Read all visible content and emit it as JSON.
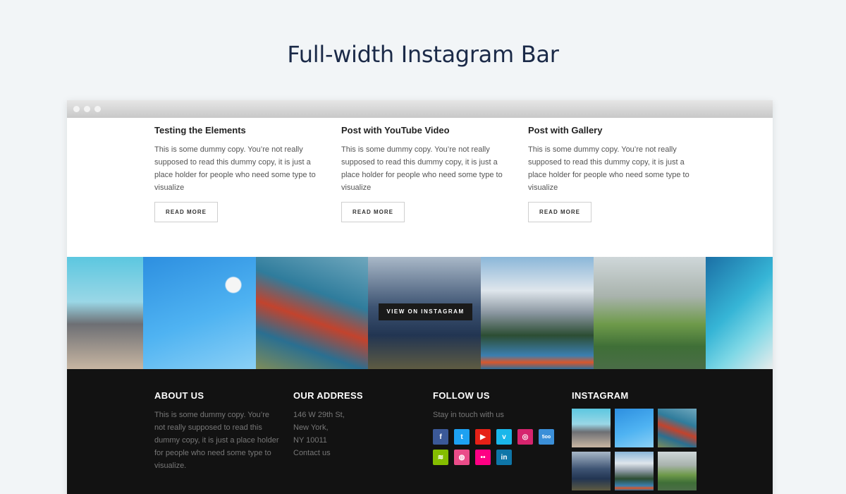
{
  "page_title": "Full-width Instagram Bar",
  "posts": [
    {
      "title": "Testing the Elements",
      "excerpt": "This is some dummy copy. You’re not really supposed to read this dummy copy, it is just a place holder for people who need some type to visualize",
      "button": "READ MORE"
    },
    {
      "title": "Post with YouTube Video",
      "excerpt": "This is some dummy copy. You’re not really supposed to read this dummy copy, it is just a place holder for people who need some type to visualize",
      "button": "READ MORE"
    },
    {
      "title": "Post with Gallery",
      "excerpt": "This is some dummy copy. You’re not really supposed to read this dummy copy, it is just a place holder for people who need some type to visualize",
      "button": "READ MORE"
    }
  ],
  "instagram_bar": {
    "button": "VIEW ON INSTAGRAM"
  },
  "footer": {
    "about": {
      "heading": "ABOUT US",
      "text": "This is some dummy copy. You’re not really supposed to read this dummy copy, it is just a place holder for people who need some type to visualize."
    },
    "address": {
      "heading": "OUR ADDRESS",
      "line1": "146 W 29th St,",
      "line2": "New York,",
      "line3": "NY 10011",
      "contact": "Contact us"
    },
    "follow": {
      "heading": "FOLLOW US",
      "text": "Stay in touch with us",
      "icons": [
        {
          "name": "facebook-icon",
          "glyph": "f",
          "color": "#3b5998"
        },
        {
          "name": "twitter-icon",
          "glyph": "t",
          "color": "#1da1f2"
        },
        {
          "name": "youtube-icon",
          "glyph": "▶",
          "color": "#e62117"
        },
        {
          "name": "vimeo-icon",
          "glyph": "v",
          "color": "#1ab7ea"
        },
        {
          "name": "instagram-icon",
          "glyph": "◎",
          "color": "#d6246e"
        },
        {
          "name": "500px-icon",
          "glyph": "5oo",
          "color": "#3b8fd8"
        },
        {
          "name": "spotify-icon",
          "glyph": "≋",
          "color": "#84bd00"
        },
        {
          "name": "dribbble-icon",
          "glyph": "◍",
          "color": "#ea4c89"
        },
        {
          "name": "flickr-icon",
          "glyph": "••",
          "color": "#ff0084"
        },
        {
          "name": "linkedin-icon",
          "glyph": "in",
          "color": "#0e76a8"
        }
      ]
    },
    "instagram": {
      "heading": "INSTAGRAM"
    }
  }
}
